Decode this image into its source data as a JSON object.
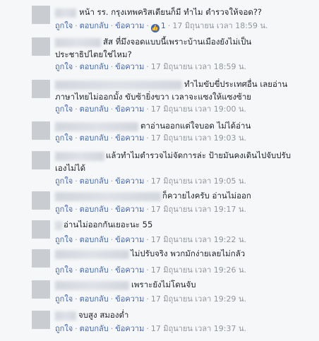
{
  "actions": {
    "like": "ถูกใจ",
    "reply": "ตอบกลับ",
    "message": "ข้อความ"
  },
  "comments": [
    {
      "text": "หน้า รร. กรุงเทพคริสเตียนก็มี ทำไม ตำรวจให้จอด??",
      "likes": "1",
      "time": "17 มิถุนายน เวลา 18:59 น."
    },
    {
      "text": "สัส ที่มึงจอดแบบนี้เพราะบ้านเมืองยังไม่เป็นประชาธิปไตยใช่ไหม?",
      "time": "17 มิถุนายน เวลา 18:59 น."
    },
    {
      "text": "ทำไมขับขี่ประเทศอื่น เลยอ่านภาษาไทยไม่ออกมั้ง ขับซ้ายิ่งขวา เวลาจะแซงให้แซงซ้าย",
      "time": "17 มิถุนายน เวลา 19:00 น."
    },
    {
      "text": "ตาอ่านออกแต่ใจบอด ไม่ได้อ่าน",
      "time": "17 มิถุนายน เวลา 19:03 น."
    },
    {
      "text": "แล้วทำไมตำรวจไม่จัดการล่ะ ป้ายมันคงเดินไปจับปรับเองไม่ได้",
      "time": "17 มิถุนายน เวลา 19:05 น."
    },
    {
      "text": "ก็ควายไงครับ อ่านไม่ออก",
      "time": "17 มิถุนายน เวลา 19:17 น."
    },
    {
      "text": "อ่านไม่ออกกันเยอะนะ 55",
      "time": "17 มิถุนายน เวลา 19:22 น."
    },
    {
      "text": "ไม่ปรับจริง พวกมักง่ายเลยไม่กลัว",
      "time": "17 มิถุนายน เวลา 19:26 น."
    },
    {
      "text": "เพราะยังไม่โดนจับ",
      "time": "17 มิถุนายน เวลา 19:29 น."
    },
    {
      "text": "จบสูง สมองต่ำ",
      "time": "17 มิถุนายน เวลา 19:37 น."
    }
  ]
}
